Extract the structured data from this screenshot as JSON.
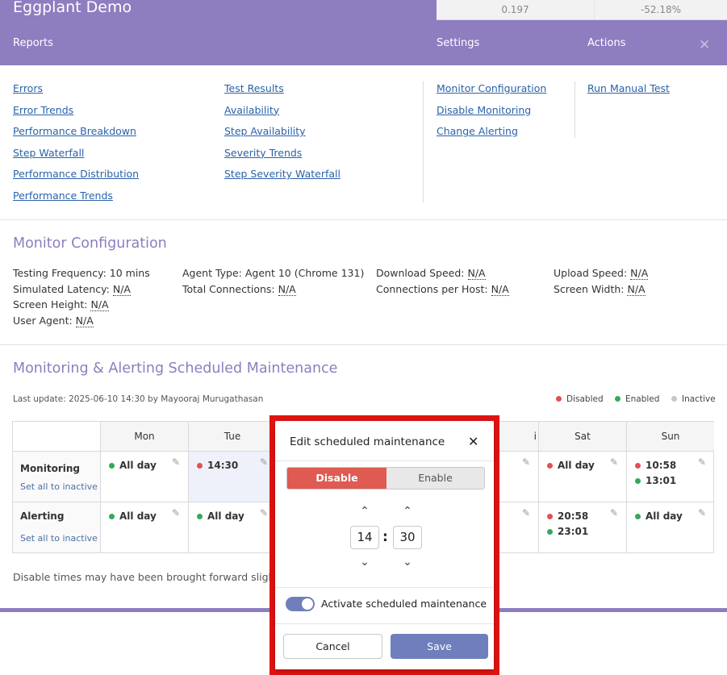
{
  "header": {
    "title": "Eggplant Demo",
    "stat_1": "0.197",
    "stat_2": "-52.18%"
  },
  "menu": {
    "reports": "Reports",
    "settings": "Settings",
    "actions": "Actions",
    "close_icon": "close-icon"
  },
  "reports_col1": [
    "Errors",
    "Error Trends",
    "Performance Breakdown",
    "Step Waterfall",
    "Performance Distribution",
    "Performance Trends"
  ],
  "reports_col2": [
    "Test Results",
    "Availability",
    "Step Availability",
    "Severity Trends",
    "Step Severity Waterfall"
  ],
  "settings_links": [
    "Monitor Configuration",
    "Disable Monitoring",
    "Change Alerting"
  ],
  "actions_links": [
    "Run Manual Test"
  ],
  "monitor_config": {
    "title": "Monitor Configuration",
    "testing_frequency": "Testing Frequency: 10 mins",
    "agent_type": "Agent Type: Agent 10 (Chrome 131)",
    "download_speed_label": "Download Speed:",
    "upload_speed_label": "Upload Speed:",
    "simulated_latency_label": "Simulated Latency:",
    "total_connections_label": "Total Connections:",
    "connections_per_host_label": "Connections per Host:",
    "screen_width_label": "Screen Width:",
    "screen_height_label": "Screen Height:",
    "user_agent_label": "User Agent:",
    "na": "N/A"
  },
  "maintenance": {
    "title": "Monitoring & Alerting Scheduled Maintenance",
    "last_update": "Last update: 2025-06-10 14:30 by Mayooraj Murugathasan",
    "legend": {
      "disabled": "Disabled",
      "enabled": "Enabled",
      "inactive": "Inactive"
    },
    "days": [
      "Mon",
      "Tue",
      "Sat",
      "Sun"
    ],
    "day_partial": "i",
    "rows": {
      "monitoring": "Monitoring",
      "alerting": "Alerting",
      "set_inactive": "Set all to inactive"
    },
    "cells": {
      "mon_monitoring": "All day",
      "tue_monitoring": "14:30",
      "sat_monitoring": "All day",
      "sun_monitoring_1": "10:58",
      "sun_monitoring_2": "13:01",
      "mon_alerting": "All day",
      "tue_alerting": "All day",
      "sat_alerting_1": "20:58",
      "sat_alerting_2": "23:01",
      "sun_alerting": "All day"
    },
    "colors": {
      "disabled": "#e05252",
      "enabled": "#36a85a",
      "inactive": "#c7c7c7"
    },
    "note": "Disable times may have been brought forward slightly"
  },
  "modal": {
    "title": "Edit scheduled maintenance",
    "disable": "Disable",
    "enable": "Enable",
    "hour": "14",
    "minute": "30",
    "colon": ":",
    "toggle_label": "Activate scheduled maintenance",
    "toggle_on": true,
    "cancel": "Cancel",
    "save": "Save"
  },
  "colors": {
    "brand": "#8e7dbf",
    "link": "#2a62a8",
    "highlight": "#e31313",
    "primary_button": "#6f7fbd",
    "disable_segment": "#df5a50"
  }
}
